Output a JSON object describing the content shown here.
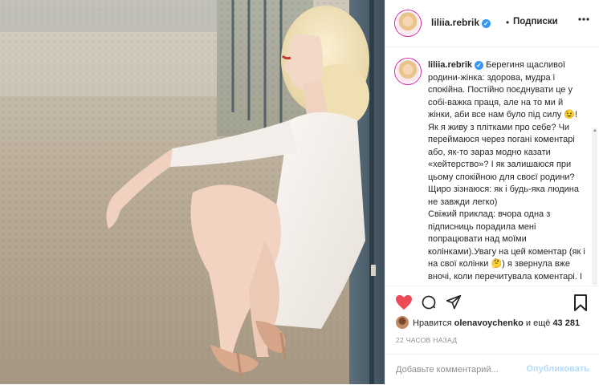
{
  "post": {
    "username": "liliia.rebrik",
    "verified_mark": "✓",
    "separator": "•",
    "follow_status": "Подписки",
    "caption": {
      "username": "liliia.rebrik",
      "text_part1": "Берегиня щасливої родини-жінка: здорова, мудра і спокійна. Постійно поєднувати це у собі-важка праця, але на то ми й жінки, аби все нам було під силу ",
      "emoji1": "😉",
      "text_part2": "! Як я живу з плітками про себе? Чи переймаюся через погані коментарі або, як-то зараз модно казати «хейтерство»? І як залишаюся при цьому спокійною для своєї родини? Щиро зізнаюся: як і будь-яка людина не завжди легко)\nСвіжий приклад: вчора одна з підписниць порадила мені попрацювати над моїми колінками).Увагу на цей коментар (як і на свої колінки ",
      "emoji2": "🤔",
      "text_part3": ") я звернула вже вночі, коли перечитувала коментарі. І засмутилася на сон"
    },
    "likes": {
      "prefix": "Нравится",
      "user": "olenavoychenko",
      "connector": "и ещё",
      "count": "43 281"
    },
    "time_ago": "22 ЧАСОВ НАЗАД",
    "comment": {
      "placeholder": "Добавьте комментарий...",
      "publish_label": "Опубликовать"
    },
    "icons": {
      "like": "heart-icon",
      "comment": "comment-icon",
      "share": "share-icon",
      "save": "bookmark-icon",
      "more": "more-icon"
    },
    "colors": {
      "like_red": "#ed4956",
      "verified_blue": "#3897f0",
      "publish_disabled": "#b3dbff"
    }
  }
}
